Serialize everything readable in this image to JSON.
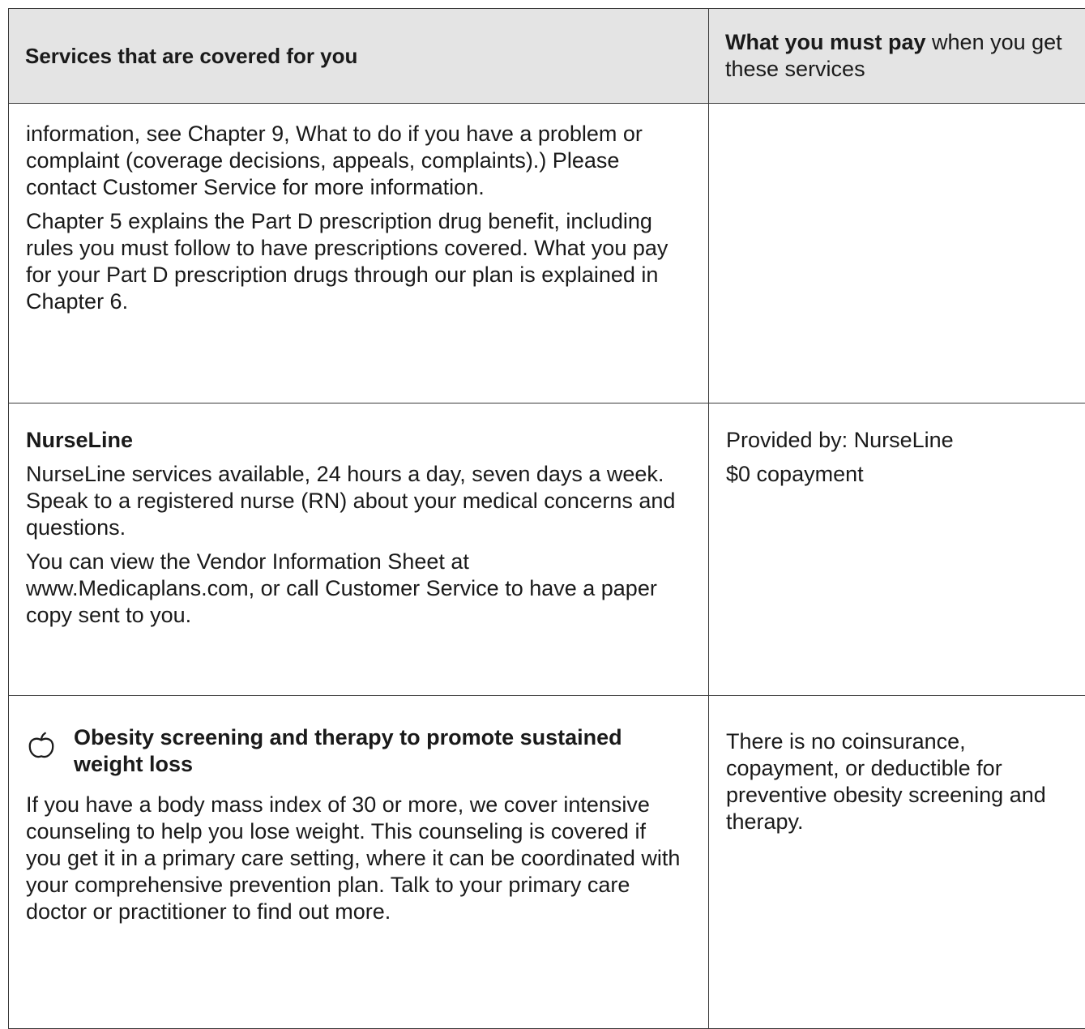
{
  "header": {
    "services_label": "Services that are covered for you",
    "pay_label_bold": "What you must pay",
    "pay_label_rest": " when you get these services"
  },
  "rows": [
    {
      "paragraphs": [
        "information, see Chapter 9, What to do if you have a problem or complaint (coverage decisions, appeals, complaints).) Please contact Customer Service for more information.",
        "Chapter 5 explains the Part D prescription drug benefit, including rules you must follow to have prescriptions covered. What you pay for your Part D prescription drugs through our plan is explained in Chapter 6."
      ],
      "pay": []
    },
    {
      "title": "NurseLine",
      "paragraphs": [
        "NurseLine services available, 24 hours a day, seven days a week. Speak to a registered nurse (RN) about your medical concerns and questions.",
        "You can view the Vendor Information Sheet at www.Medicaplans.com, or call Customer Service to have a paper copy sent to you."
      ],
      "pay": [
        "Provided by: NurseLine",
        "$0 copayment"
      ]
    },
    {
      "icon": "apple-icon",
      "title": "Obesity screening and therapy to promote sustained weight loss",
      "paragraphs": [
        "If you have a body mass index of 30 or more, we cover intensive counseling to help you lose weight. This counseling is covered if you get it in a primary care setting, where it can be coordinated with your comprehensive prevention plan. Talk to your primary care doctor or practitioner to find out more."
      ],
      "pay": [
        "There is no coinsurance, copayment, or deductible for preventive obesity screening and therapy."
      ]
    }
  ]
}
